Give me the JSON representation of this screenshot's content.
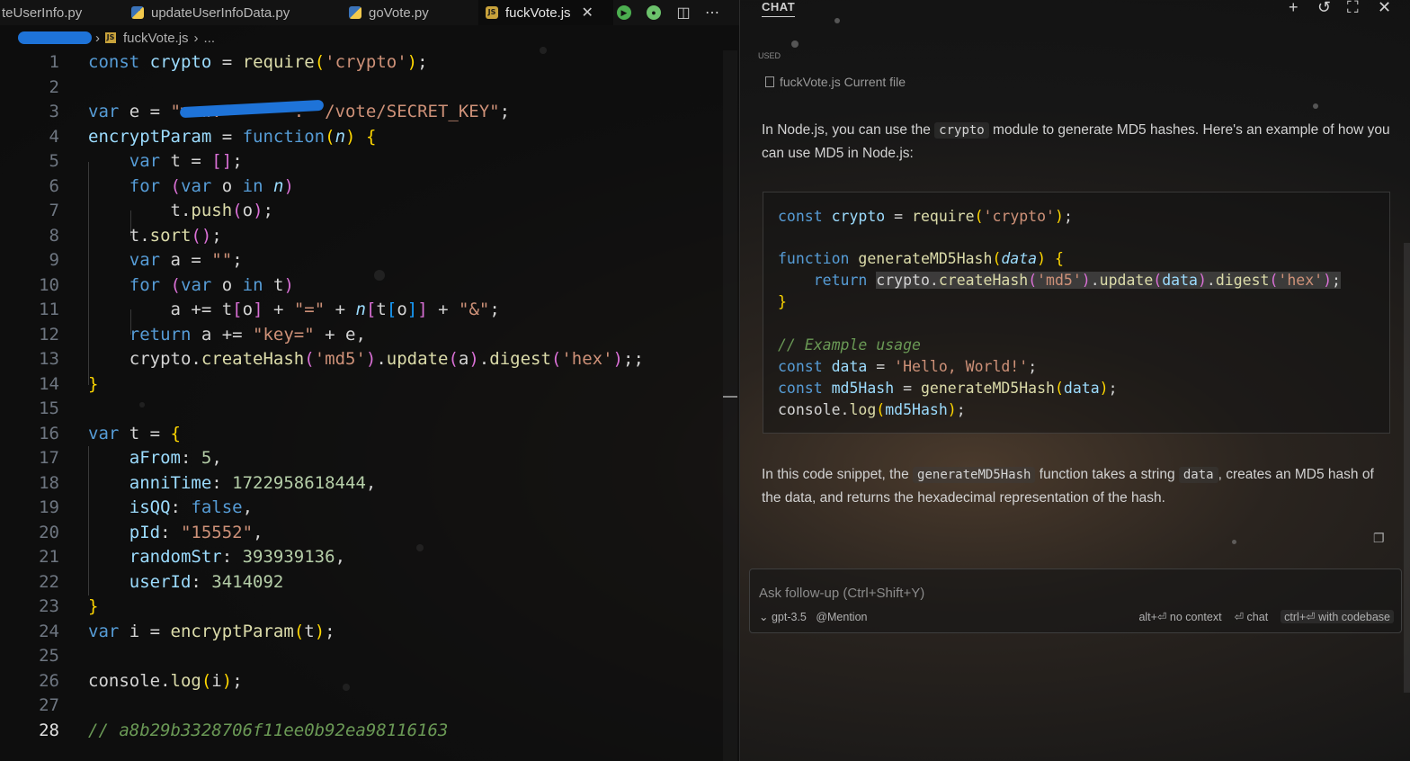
{
  "tabs": [
    {
      "label": "teUserInfo.py",
      "type": "py"
    },
    {
      "label": "updateUserInfoData.py",
      "type": "py"
    },
    {
      "label": "goVote.py",
      "type": "py"
    },
    {
      "label": "fuckVote.js",
      "type": "js",
      "active": true
    }
  ],
  "breadcrumb": {
    "file": "fuckVote.js",
    "tail": "..."
  },
  "code": {
    "current_line": 28,
    "line_numbers": [
      "1",
      "2",
      "3",
      "4",
      "5",
      "6",
      "7",
      "8",
      "9",
      "10",
      "11",
      "12",
      "13",
      "14",
      "15",
      "16",
      "17",
      "18",
      "19",
      "20",
      "21",
      "22",
      "23",
      "24",
      "25",
      "26",
      "27",
      "28"
    ],
    "comment_last": "// a8b29b3328706f11ee0b92ea98116163"
  },
  "chat": {
    "title": "CHAT",
    "used_label": "USED",
    "used_file": "fuckVote.js Current file",
    "intro_a": "In Node.js, you can use the",
    "intro_code": "crypto",
    "intro_b": "module to generate MD5 hashes. Here's an example of how you can use MD5 in Node.js:",
    "outro_a": "In this code snippet, the",
    "outro_code1": "generateMD5Hash",
    "outro_b": "function takes a string",
    "outro_code2": "data",
    "outro_c": ", creates an MD5 hash of the data, and returns the hexadecimal representation of the hash.",
    "input_placeholder": "Ask follow-up (Ctrl+Shift+Y)",
    "model": "gpt-3.5",
    "mention": "Mention",
    "opt_no_context": "alt+⏎ no context",
    "opt_chat": "⏎ chat",
    "opt_codebase": "ctrl+⏎ with codebase"
  },
  "colors": {
    "accent_blue": "#1e73d8",
    "keyword": "#569cd6",
    "string": "#ce9178",
    "function": "#dcdcaa",
    "variable": "#9cdcfe",
    "number": "#b5cea8",
    "comment": "#6a9955"
  },
  "icons": {
    "run": "play-icon",
    "debug": "bug-icon",
    "split": "split-editor-icon",
    "more": "more-icon",
    "new_chat": "plus-icon",
    "history": "history-icon",
    "maximize": "maximize-icon",
    "close": "close-icon",
    "copy": "copy-icon"
  }
}
